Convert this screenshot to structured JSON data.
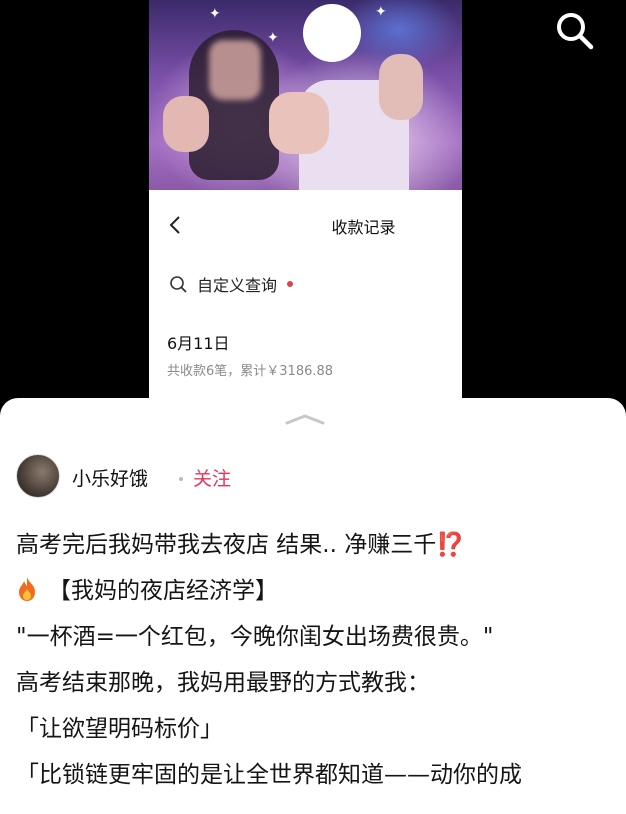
{
  "viewer": {
    "search_icon": "search-icon"
  },
  "screenshot": {
    "title": "收款记录",
    "query_label": "自定义查询",
    "date": "6月11日",
    "summary": "共收款6笔，累计￥3186.88"
  },
  "post": {
    "author": "小乐好饿",
    "follow_label": "关注",
    "lines": [
      "高考完后我妈带我去夜店 结果.. 净赚三千⁉️",
      "【我妈的夜店经济学】",
      "\"一杯酒=一个红包，今晚你闺女出场费很贵。\"",
      "高考结束那晚，我妈用最野的方式教我：",
      "「让欲望明码标价」",
      "「比锁链更牢固的是让全世界都知道——动你的成"
    ]
  },
  "colors": {
    "accent": "#e8335a",
    "dot": "#e0414f",
    "muted": "#8a8a8a"
  }
}
